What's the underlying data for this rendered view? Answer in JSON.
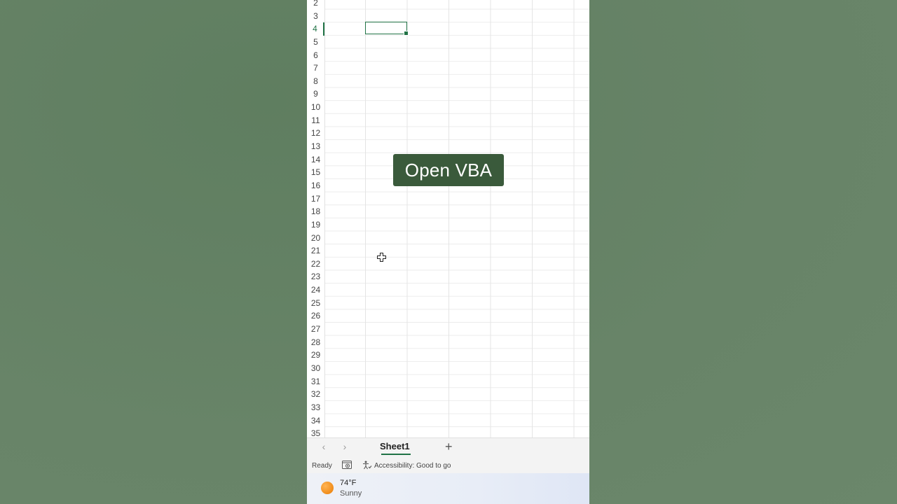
{
  "overlay": {
    "caption": "Open VBA"
  },
  "grid": {
    "row_numbers": [
      "2",
      "3",
      "4",
      "5",
      "6",
      "7",
      "8",
      "9",
      "10",
      "11",
      "12",
      "13",
      "14",
      "15",
      "16",
      "17",
      "18",
      "19",
      "20",
      "21",
      "22",
      "23",
      "24",
      "25",
      "26",
      "27",
      "28",
      "29",
      "30",
      "31",
      "32",
      "33",
      "34",
      "35"
    ],
    "active_row": "4"
  },
  "sheet_tabs": {
    "prev_icon": "chevron-left-icon",
    "next_icon": "chevron-right-icon",
    "active_sheet": "Sheet1",
    "add_icon": "plus-icon"
  },
  "status_bar": {
    "ready": "Ready",
    "macro_icon": "macro-recording-icon",
    "accessibility_icon": "accessibility-icon",
    "accessibility_text": "Accessibility: Good to go"
  },
  "taskbar": {
    "weather_icon": "sun-icon",
    "temperature": "74°F",
    "condition": "Sunny"
  },
  "colors": {
    "background": "#688468",
    "accent": "#217346",
    "caption_bg": "#3a5a3b"
  }
}
